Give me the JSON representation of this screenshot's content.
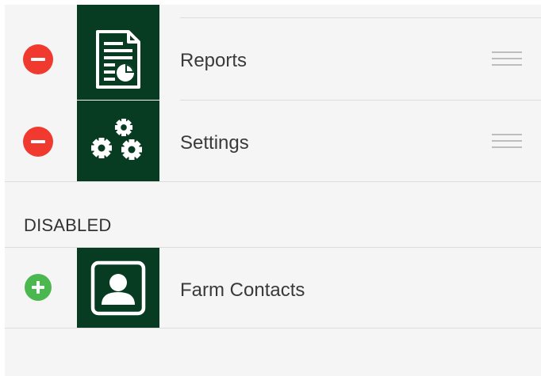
{
  "enabled_items": [
    {
      "label": "Reports",
      "icon": "reports-icon",
      "action_icon": "remove-icon"
    },
    {
      "label": "Settings",
      "icon": "settings-gears-icon",
      "action_icon": "remove-icon"
    }
  ],
  "disabled_section": {
    "title": "DISABLED",
    "items": [
      {
        "label": "Farm Contacts",
        "icon": "contact-card-icon",
        "action_icon": "add-icon"
      }
    ]
  },
  "colors": {
    "tile_background": "#073b22",
    "remove_button": "#f0392f",
    "add_button": "#4ab84f",
    "background": "#f5f5f5"
  }
}
